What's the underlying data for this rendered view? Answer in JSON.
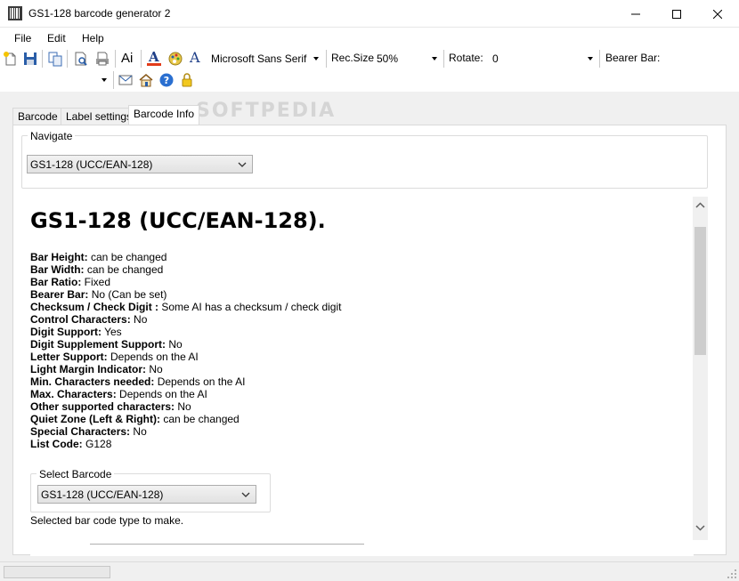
{
  "window": {
    "title": "GS1-128 barcode generator 2"
  },
  "menu": [
    "File",
    "Edit",
    "Help"
  ],
  "toolbar": {
    "font_name": "Microsoft Sans Serif",
    "recsize_label": "Rec.Size",
    "recsize_value": "50%",
    "rotate_label": "Rotate:",
    "rotate_value": "0",
    "bearer_label": "Bearer Bar:",
    "text_button": "Ai",
    "font_letter": "A",
    "font_letter2": "A",
    "icons": [
      "new-file-icon",
      "save-icon",
      "copy-icon",
      "print-preview-icon",
      "print-icon",
      "text-icon",
      "font-color-icon",
      "palette-icon",
      "font-icon",
      "email-icon",
      "home-icon",
      "help-icon",
      "lock-icon"
    ]
  },
  "watermark": "SOFTPEDIA",
  "tabs": [
    {
      "label": "Barcode",
      "active": false
    },
    {
      "label": "Label settings",
      "active": false
    },
    {
      "label": "Barcode Info",
      "active": true
    }
  ],
  "navigate": {
    "label": "Navigate",
    "value": "GS1-128 (UCC/EAN-128)"
  },
  "info": {
    "title": "GS1-128 (UCC/EAN-128).",
    "properties": [
      {
        "key": "Bar Height:",
        "value": " can be changed"
      },
      {
        "key": "Bar Width:",
        "value": " can be changed"
      },
      {
        "key": "Bar Ratio:",
        "value": " Fixed"
      },
      {
        "key": "Bearer Bar:",
        "value": " No (Can be set)"
      },
      {
        "key": "Checksum / Check Digit :",
        "value": " Some AI has a checksum / check digit"
      },
      {
        "key": "Control Characters:",
        "value": " No"
      },
      {
        "key": "Digit Support:",
        "value": " Yes"
      },
      {
        "key": "Digit Supplement Support:",
        "value": " No"
      },
      {
        "key": "Letter Support:",
        "value": " Depends on the AI"
      },
      {
        "key": "Light Margin Indicator:",
        "value": " No"
      },
      {
        "key": "Min. Characters needed:",
        "value": " Depends on the AI"
      },
      {
        "key": "Max. Characters:",
        "value": " Depends on the AI"
      },
      {
        "key": "Other supported characters:",
        "value": " No"
      },
      {
        "key": "Quiet Zone (Left & Right):",
        "value": " can be changed"
      },
      {
        "key": "Special Characters:",
        "value": " No"
      },
      {
        "key": "List Code:",
        "value": " G128"
      }
    ],
    "select_barcode": {
      "label": "Select Barcode",
      "value": "GS1-128 (UCC/EAN-128)"
    },
    "selected_desc": "Selected bar code type to make."
  }
}
